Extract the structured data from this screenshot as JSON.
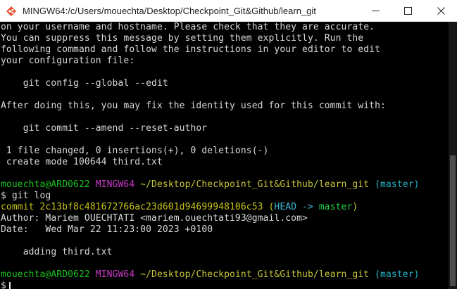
{
  "window": {
    "title": "MINGW64:/c/Users/mouechta/Desktop/Checkpoint_Git&Github/learn_git"
  },
  "terminal": {
    "lines": [
      {
        "segments": [
          {
            "text": "on your username and hostname. Please check that they are accurate.",
            "color": "default"
          }
        ]
      },
      {
        "segments": [
          {
            "text": "You can suppress this message by setting them explicitly. Run the",
            "color": "default"
          }
        ]
      },
      {
        "segments": [
          {
            "text": "following command and follow the instructions in your editor to edit",
            "color": "default"
          }
        ]
      },
      {
        "segments": [
          {
            "text": "your configuration file:",
            "color": "default"
          }
        ]
      },
      {
        "segments": [
          {
            "text": "",
            "color": "default"
          }
        ]
      },
      {
        "segments": [
          {
            "text": "    git config --global --edit",
            "color": "default"
          }
        ]
      },
      {
        "segments": [
          {
            "text": "",
            "color": "default"
          }
        ]
      },
      {
        "segments": [
          {
            "text": "After doing this, you may fix the identity used for this commit with:",
            "color": "default"
          }
        ]
      },
      {
        "segments": [
          {
            "text": "",
            "color": "default"
          }
        ]
      },
      {
        "segments": [
          {
            "text": "    git commit --amend --reset-author",
            "color": "default"
          }
        ]
      },
      {
        "segments": [
          {
            "text": "",
            "color": "default"
          }
        ]
      },
      {
        "segments": [
          {
            "text": " 1 file changed, 0 insertions(+), 0 deletions(-)",
            "color": "default"
          }
        ]
      },
      {
        "segments": [
          {
            "text": " create mode 100644 third.txt",
            "color": "default"
          }
        ]
      },
      {
        "segments": [
          {
            "text": "",
            "color": "default"
          }
        ]
      },
      {
        "segments": [
          {
            "text": "mouechta@ARD0622 ",
            "color": "green"
          },
          {
            "text": "MINGW64 ",
            "color": "magenta"
          },
          {
            "text": "~/Desktop/Checkpoint_Git&Github/learn_git",
            "color": "yellow"
          },
          {
            "text": " (master)",
            "color": "cyan"
          }
        ]
      },
      {
        "segments": [
          {
            "text": "$ git log",
            "color": "default"
          }
        ]
      },
      {
        "segments": [
          {
            "text": "commit 2c13bf8c481672766ac23d601d94699948106c53 ",
            "color": "ygold"
          },
          {
            "text": "(",
            "color": "ygold"
          },
          {
            "text": "HEAD -> ",
            "color": "bcyan"
          },
          {
            "text": "master",
            "color": "bgreen"
          },
          {
            "text": ")",
            "color": "ygold"
          }
        ]
      },
      {
        "segments": [
          {
            "text": "Author: Mariem OUECHTATI <mariem.ouechtati93@gmail.com>",
            "color": "default"
          }
        ]
      },
      {
        "segments": [
          {
            "text": "Date:   Wed Mar 22 11:23:00 2023 +0100",
            "color": "default"
          }
        ]
      },
      {
        "segments": [
          {
            "text": "",
            "color": "default"
          }
        ]
      },
      {
        "segments": [
          {
            "text": "    adding third.txt",
            "color": "default"
          }
        ]
      },
      {
        "segments": [
          {
            "text": "",
            "color": "default"
          }
        ]
      },
      {
        "segments": [
          {
            "text": "mouechta@ARD0622 ",
            "color": "green"
          },
          {
            "text": "MINGW64 ",
            "color": "magenta"
          },
          {
            "text": "~/Desktop/Checkpoint_Git&Github/learn_git",
            "color": "yellow"
          },
          {
            "text": " (master)",
            "color": "cyan"
          }
        ]
      },
      {
        "segments": [
          {
            "text": "$",
            "color": "default"
          }
        ],
        "cursor": true
      }
    ]
  },
  "colors": {
    "background": "#000000",
    "text": "#d9d9d9",
    "user_host": "#1dc121",
    "msystem": "#c839c5",
    "path": "#c6c43a",
    "branch": "#27b4c6"
  },
  "icons": {
    "app": "git-bash-diamond-icon",
    "minimize": "minimize-icon",
    "maximize": "maximize-icon",
    "close": "close-icon"
  }
}
